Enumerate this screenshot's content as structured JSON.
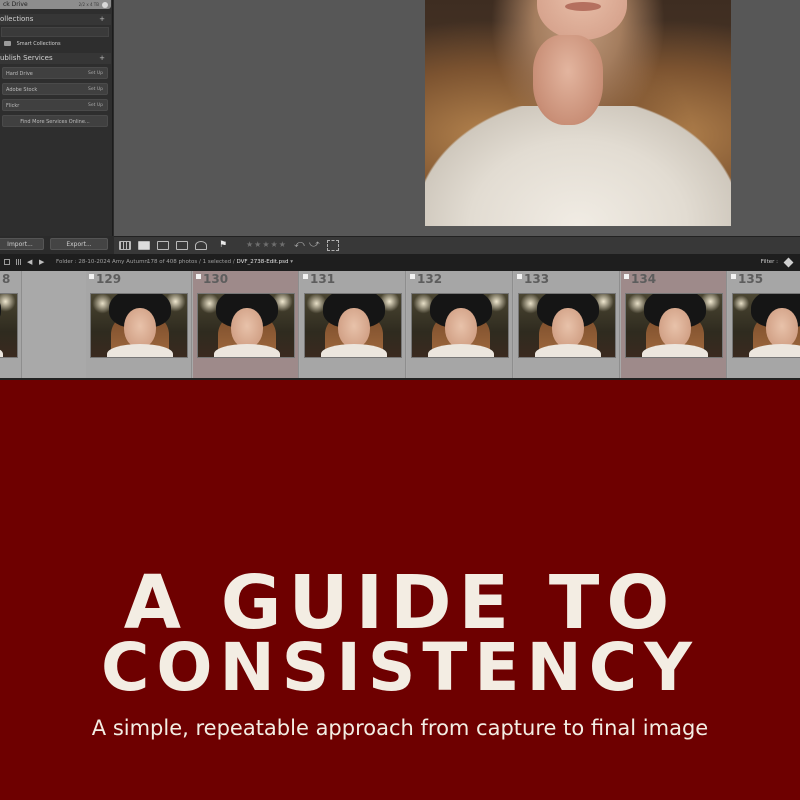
{
  "left_panel": {
    "drive_row": {
      "label": "ck Drive",
      "extra": "2/2 x 4 TB"
    },
    "collections_header": "ollections",
    "smart_collections": "Smart Collections",
    "publish_header": "ublish Services",
    "services": [
      {
        "name": "Hard Drive",
        "action": "Set Up"
      },
      {
        "name": "Adobe Stock",
        "action": "Set Up"
      },
      {
        "name": "Flickr",
        "action": "Set Up"
      }
    ],
    "find_more": "Find More Services Online...",
    "import_label": "Import...",
    "export_label": "Export..."
  },
  "toolbar": {
    "stars": "★★★★★",
    "flag": "⚑"
  },
  "nav_strip": {
    "folder": "Folder : 28-10-2024 Amy Autumn",
    "count": "178 of 408 photos / 1 selected / ",
    "filename": "DVF_2738-Edit.psd",
    "filename_suffix": " ▾",
    "filter_label": "Filter :"
  },
  "filmstrip": {
    "frames": [
      {
        "number": "8",
        "selected": false
      },
      {
        "number": "129",
        "selected": false
      },
      {
        "number": "130",
        "selected": true
      },
      {
        "number": "131",
        "selected": false
      },
      {
        "number": "132",
        "selected": false
      },
      {
        "number": "133",
        "selected": false
      },
      {
        "number": "134",
        "selected": true
      },
      {
        "number": "135",
        "selected": false
      }
    ]
  },
  "poster": {
    "title_line1": "A GUIDE TO",
    "title_line2": "CONSISTENCY",
    "subtitle": "A simple, repeatable approach from capture to final image"
  },
  "colors": {
    "background": "#6e0000",
    "title_text": "#f3ede3"
  }
}
